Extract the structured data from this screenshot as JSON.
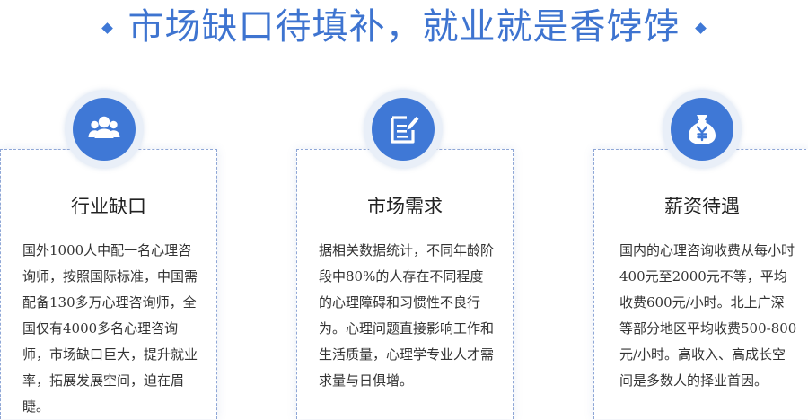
{
  "header": {
    "title": "市场缺口待填补，就业就是香饽饽"
  },
  "cards": [
    {
      "title": "行业缺口",
      "icon": "people-group-icon",
      "text": "国外1000人中配一名心理咨询师，按照国际标准，中国需配备130多万心理咨询师，全国仅有4000多名心理咨询师，市场缺口巨大，提升就业率，拓展发展空间，迫在眉睫。"
    },
    {
      "title": "市场需求",
      "icon": "document-edit-icon",
      "text": "据相关数据统计，不同年龄阶段中80%的人存在不同程度的心理障碍和习惯性不良行为。心理问题直接影响工作和生活质量，心理学专业人才需求量与日俱增。"
    },
    {
      "title": "薪资待遇",
      "icon": "money-bag-icon",
      "text": "国内的心理咨询收费从每小时400元至2000元不等，平均收费600元/小时。北上广深等部分地区平均收费500-800元/小时。高收入、高成长空间是多数人的择业首因。"
    }
  ],
  "colors": {
    "accent": "#3f78d6",
    "title": "#3e74d0",
    "badge_bg": "#e9eff8"
  }
}
